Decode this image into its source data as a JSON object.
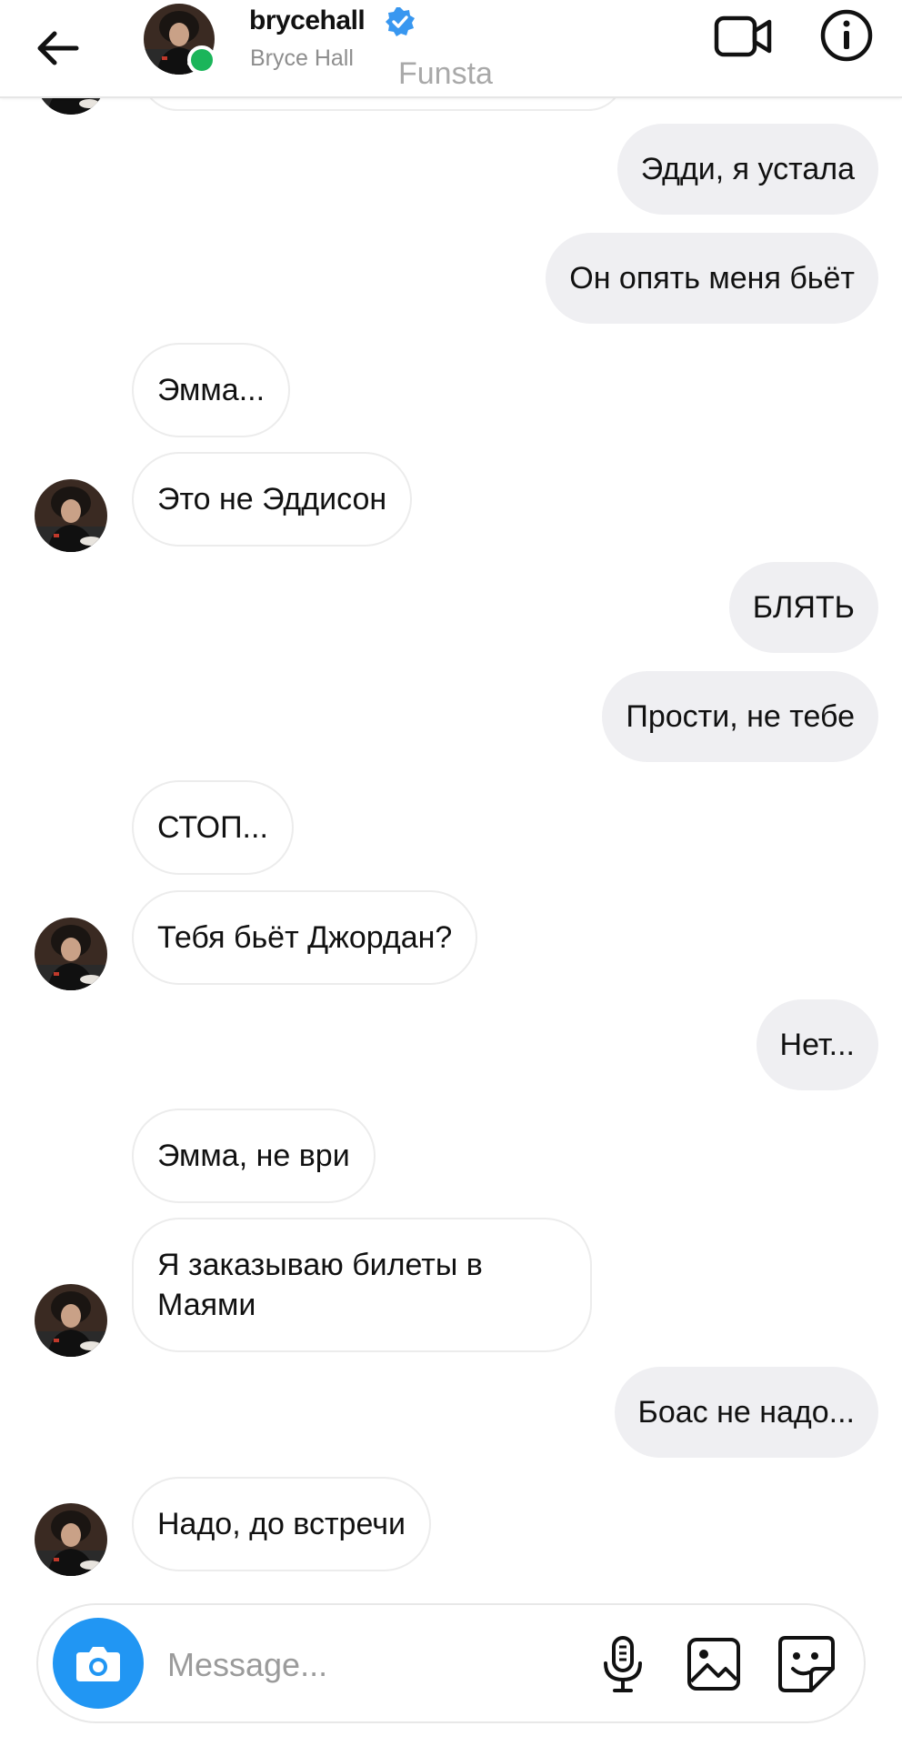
{
  "header": {
    "username": "brycehall",
    "full_name": "Bryce Hall",
    "verified": true,
    "online": true,
    "watermark": "Funsta"
  },
  "messages": [
    {
      "side": "out",
      "text": "Эдди, я устала"
    },
    {
      "side": "out",
      "text": "Он опять меня бьёт"
    },
    {
      "side": "in",
      "text": "Эмма..."
    },
    {
      "side": "in",
      "text": "Это не Эддисон",
      "avatar": true
    },
    {
      "side": "out",
      "text": "БЛЯТЬ"
    },
    {
      "side": "out",
      "text": "Прости, не тебе"
    },
    {
      "side": "in",
      "text": "СТОП..."
    },
    {
      "side": "in",
      "text": "Тебя бьёт Джордан?",
      "avatar": true
    },
    {
      "side": "out",
      "text": "Нет..."
    },
    {
      "side": "in",
      "text": "Эмма, не ври"
    },
    {
      "side": "in",
      "text": "Я заказываю билеты в\nМаями",
      "avatar": true
    },
    {
      "side": "out",
      "text": "Боас не надо..."
    },
    {
      "side": "in",
      "text": "Надо, до встречи",
      "avatar": true
    }
  ],
  "composer": {
    "placeholder": "Message..."
  },
  "colors": {
    "online": "#1bb55a",
    "verified": "#3897f0",
    "camera_button": "#2196f3",
    "outgoing_bubble": "#efeff2",
    "incoming_border": "#ececec"
  },
  "icons": [
    "back-arrow-icon",
    "verified-badge-icon",
    "video-call-icon",
    "info-icon",
    "camera-icon",
    "microphone-icon",
    "gallery-icon",
    "sticker-icon"
  ]
}
